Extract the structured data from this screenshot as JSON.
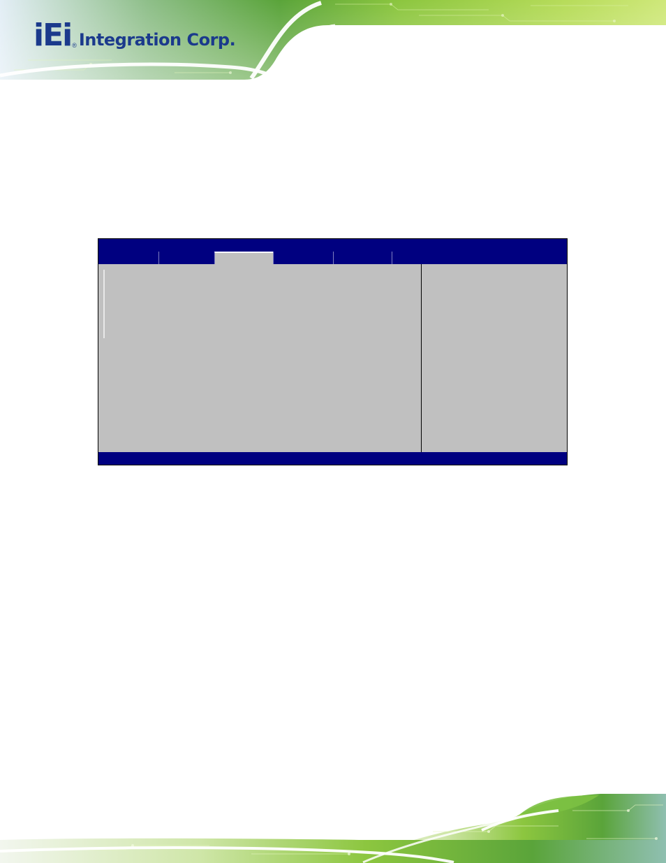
{
  "header": {
    "logo_mark": "iEi",
    "logo_registered": "®",
    "logo_text": "Integration Corp."
  },
  "colors": {
    "bios_blue": "#000080",
    "bios_gray": "#c0c0c0",
    "banner_green": "#7cc142",
    "logo_blue": "#1b3a8c"
  },
  "bios": {
    "tabs": [
      {
        "label": "",
        "active": false
      },
      {
        "label": "",
        "active": false
      },
      {
        "label": "",
        "active": true
      },
      {
        "label": "",
        "active": false
      },
      {
        "label": "",
        "active": false
      }
    ]
  },
  "icons": {
    "logo": "iei-logo-icon"
  }
}
